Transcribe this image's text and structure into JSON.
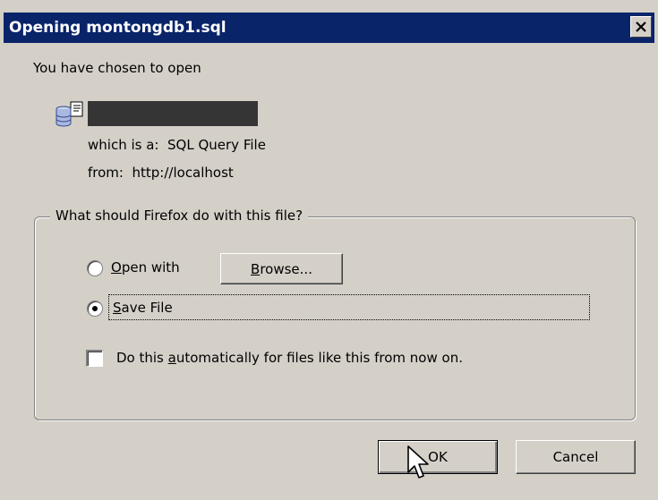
{
  "window": {
    "title": "Opening montongdb1.sql",
    "close_glyph": "✕"
  },
  "intro": {
    "chosen_text": "You have chosen to open",
    "which_is_label": "which is a:",
    "which_is_value": "SQL Query File",
    "from_label": "from:",
    "from_value": "http://localhost"
  },
  "group": {
    "legend": "What should Firefox do with this file?",
    "open_with": {
      "accel": "O",
      "rest": "pen with",
      "selected": false
    },
    "browse_button": {
      "accel": "B",
      "rest": "rowse..."
    },
    "save_file": {
      "accel": "S",
      "rest": "ave File",
      "selected": true
    },
    "auto_checkbox": {
      "pre": "Do this ",
      "accel": "a",
      "post": "utomatically for files like this from now on.",
      "checked": false
    }
  },
  "buttons": {
    "ok": "OK",
    "cancel": "Cancel"
  },
  "icons": {
    "file": "sql-file-icon",
    "cursor": "mouse-pointer-icon",
    "close": "close-icon"
  },
  "colors": {
    "titlebar": "#0a246a",
    "face": "#d4d0c8",
    "redaction": "#353535"
  }
}
